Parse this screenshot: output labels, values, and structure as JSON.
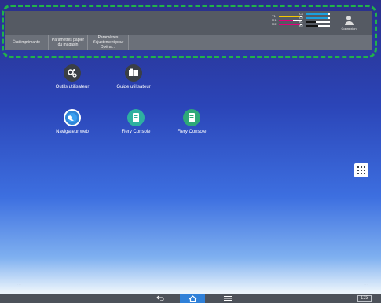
{
  "tabs": [
    {
      "label": "État imprimante"
    },
    {
      "label": "Paramètres papier du magasin"
    },
    {
      "label": "Paramètres d'ajustement pour Opérat..."
    }
  ],
  "login": {
    "label": "Connexion"
  },
  "toner_left": [
    {
      "label": "Y1",
      "color": "#f5c800",
      "level": 0.9
    },
    {
      "label": "M1",
      "color": "#e0007a",
      "level": 0.6
    },
    {
      "label": "M2",
      "color": "#e0007a",
      "level": 0.9
    }
  ],
  "toner_right": [
    {
      "label": "C1",
      "color": "#1aa0e0",
      "level": 0.9
    },
    {
      "label": "C2",
      "color": "#1aa0e0",
      "level": 0.9
    },
    {
      "label": "K1",
      "color": "#111111",
      "level": 0.4
    },
    {
      "label": "K2",
      "color": "#111111",
      "level": 0.5
    }
  ],
  "apps": [
    {
      "label": "Outils utilisateur",
      "icon": "gears-icon"
    },
    {
      "label": "Guide utilisateur",
      "icon": "book-icon"
    },
    {
      "label": "Navigateur web",
      "icon": "globe-icon"
    },
    {
      "label": "Fiery Console",
      "icon": "fiery-console-icon"
    },
    {
      "label": "Fiery Console",
      "icon": "fiery-console-icon"
    }
  ],
  "colors": {
    "accent": "#2f80d8",
    "highlight": "#21b24a"
  },
  "keyboard": {
    "label": "123"
  }
}
